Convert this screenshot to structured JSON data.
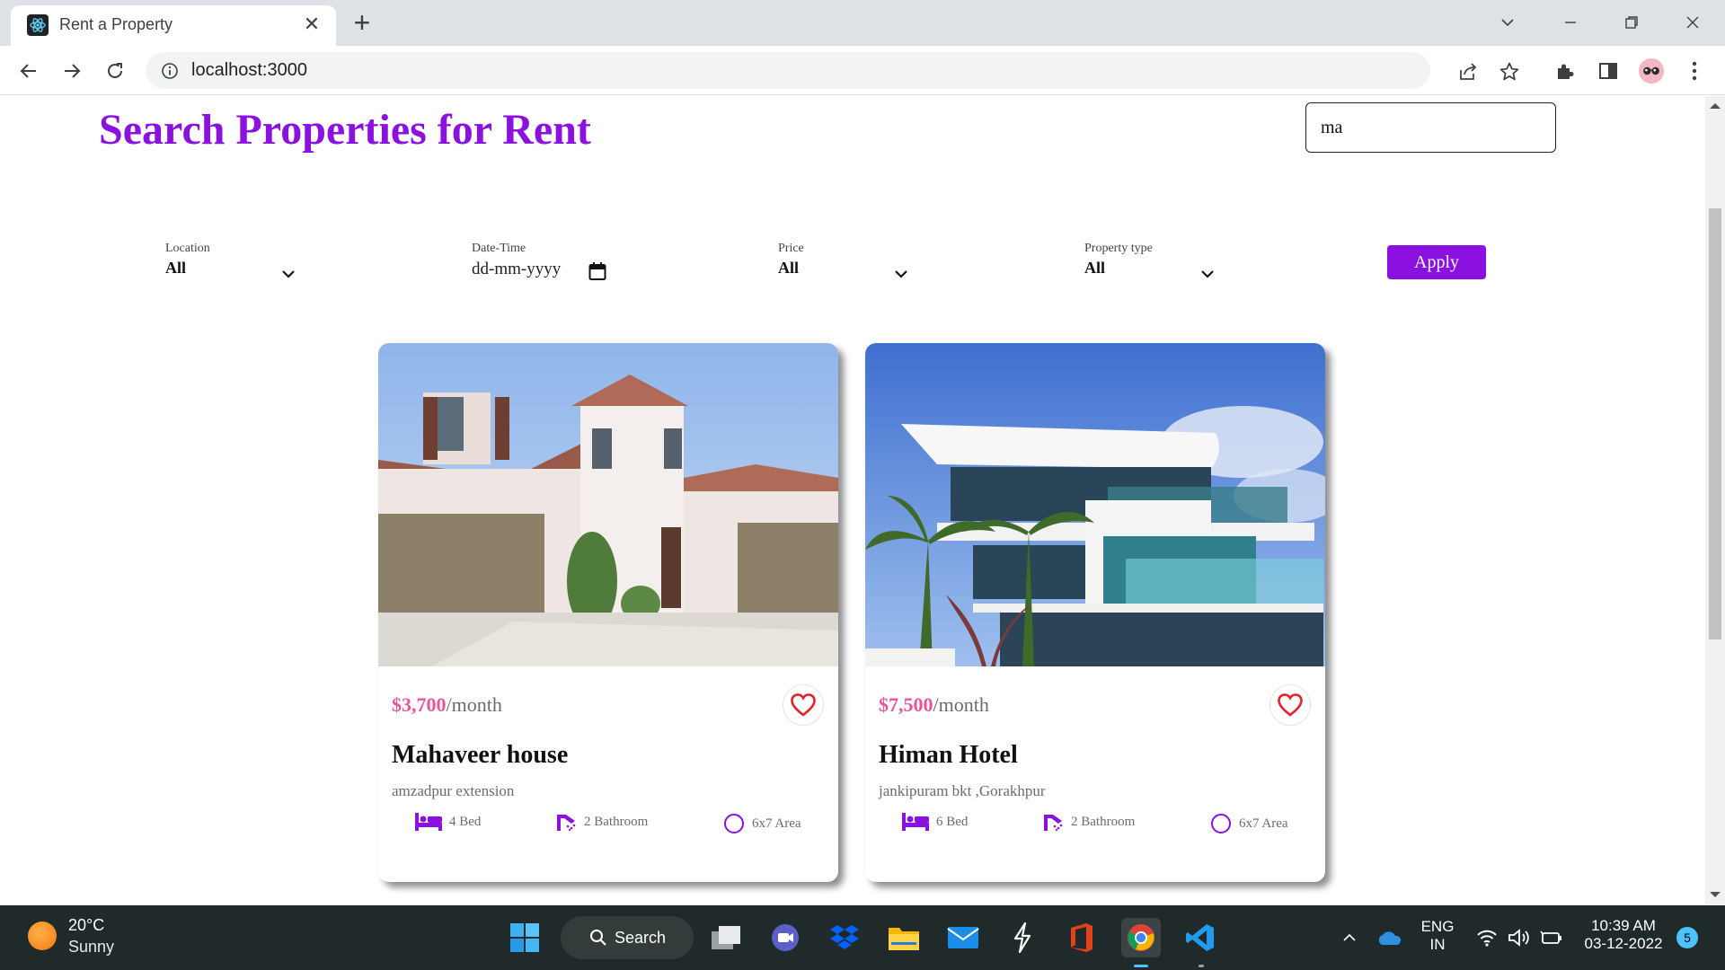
{
  "browser": {
    "tab_title": "Rent a Property",
    "url": "localhost:3000"
  },
  "page": {
    "title": "Search Properties for Rent",
    "search_value": "ma",
    "filters": {
      "location": {
        "label": "Location",
        "value": "All"
      },
      "datetime": {
        "label": "Date-Time",
        "value": "dd-mm-yyyy"
      },
      "price": {
        "label": "Price",
        "value": "All"
      },
      "property_type": {
        "label": "Property type",
        "value": "All"
      }
    },
    "apply_label": "Apply",
    "listings": [
      {
        "price": "$3,700",
        "period": "/month",
        "name": "Mahaveer house",
        "address": "amzadpur extension",
        "beds": "4 Bed",
        "baths": "2 Bathroom",
        "area": "6x7 Area"
      },
      {
        "price": "$7,500",
        "period": "/month",
        "name": "Himan Hotel",
        "address": "jankipuram bkt ,Gorakhpur",
        "beds": "6 Bed",
        "baths": "2 Bathroom",
        "area": "6x7 Area"
      }
    ]
  },
  "taskbar": {
    "weather_temp": "20°C",
    "weather_condition": "Sunny",
    "search_label": "Search",
    "lang_top": "ENG",
    "lang_bottom": "IN",
    "time": "10:39 AM",
    "date": "03-12-2022",
    "notification_count": "5"
  },
  "colors": {
    "accent": "#8a11e0",
    "price": "#e8559d",
    "heart": "#e5212b"
  }
}
